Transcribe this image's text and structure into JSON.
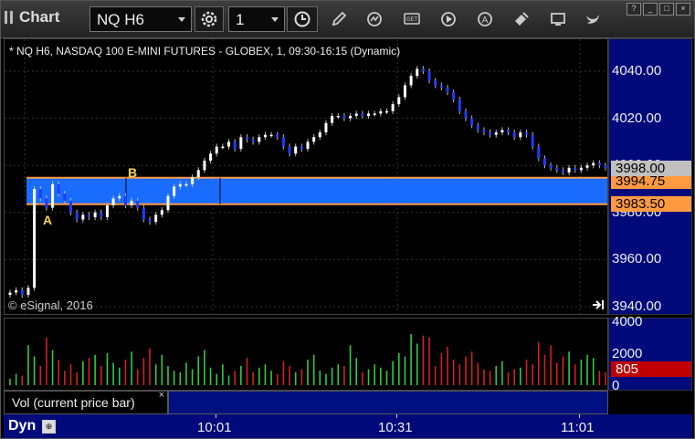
{
  "toolbar": {
    "title": "Chart",
    "symbol": "NQ H6",
    "interval": "1",
    "icons": [
      "settings-icon",
      "clock-icon",
      "pencil-icon",
      "refresh-icon",
      "get-icon",
      "play-icon",
      "alert-icon",
      "eraser-icon",
      "screen-icon",
      "bird-icon"
    ],
    "window_controls": [
      "?",
      "_",
      "□",
      "×"
    ]
  },
  "chart": {
    "header": "* NQ H6, NASDAQ 100 E-MINI FUTURES - GLOBEX, 1, 09:30-16:15 (Dynamic)",
    "copyright": "© eSignal, 2016",
    "label_a": "A",
    "label_b": "B",
    "last_price": "3998.00",
    "band_upper_label": "3994.75",
    "band_lower_label": "3983.50",
    "band_color": "#1a6cff",
    "band_border_color": "#ff9a40",
    "up_color": "#ffffff",
    "down_color": "#1f3cff"
  },
  "chart_data": {
    "type": "candlestick",
    "y_ticks": [
      "4040.00",
      "4020.00",
      "4000.00",
      "3980.00",
      "3960.00",
      "3940.00"
    ],
    "ylim": [
      3935,
      4045
    ],
    "x_ticks": [
      "10:01",
      "10:31",
      "11:01"
    ],
    "band": {
      "upper": 3994.75,
      "lower": 3983.5
    },
    "close_series": [
      3946,
      3947,
      3945,
      3948,
      3990,
      3986,
      3982,
      3992,
      3988,
      3985,
      3980,
      3977,
      3979,
      3978,
      3980,
      3978,
      3983,
      3986,
      3987,
      3983,
      3985,
      3982,
      3977,
      3976,
      3979,
      3981,
      3987,
      3991,
      3992,
      3992,
      3995,
      3998,
      4002,
      4005,
      4008,
      4008,
      4010,
      4007,
      4012,
      4011,
      4010,
      4012,
      4013,
      4013,
      4012,
      4008,
      4005,
      4008,
      4007,
      4010,
      4012,
      4014,
      4018,
      4021,
      4021,
      4020,
      4021,
      4022,
      4021,
      4022,
      4022,
      4023,
      4023,
      4026,
      4029,
      4034,
      4038,
      4041,
      4040,
      4036,
      4034,
      4033,
      4031,
      4028,
      4023,
      4020,
      4017,
      4015,
      4014,
      4013,
      4014,
      4015,
      4014,
      4012,
      4014,
      4013,
      4008,
      4003,
      4000,
      3999,
      3998,
      3997,
      3999,
      3998,
      3999,
      4000,
      4001,
      4000,
      3999
    ],
    "volume": {
      "y_ticks": [
        "4000",
        "2000",
        "0"
      ],
      "ylim": [
        0,
        4000
      ],
      "last_value": "805",
      "label": "Vol (current price bar)",
      "values": [
        400,
        700,
        600,
        2500,
        1800,
        1200,
        3000,
        2200,
        1600,
        900,
        1300,
        800,
        1500,
        1700,
        1900,
        1200,
        2000,
        1400,
        1100,
        1600,
        2100,
        1000,
        1700,
        2300,
        1300,
        1900,
        1200,
        900,
        800,
        1400,
        1000,
        1800,
        2200,
        1100,
        700,
        1300,
        600,
        900,
        1200,
        1700,
        800,
        1100,
        1300,
        900,
        700,
        1500,
        1200,
        800,
        1000,
        1600,
        1900,
        900,
        700,
        1100,
        1300,
        1200,
        2500,
        1700,
        800,
        1000,
        1300,
        1100,
        900,
        1500,
        2000,
        1800,
        3200,
        2600,
        3100,
        3000,
        1200,
        2000,
        2400,
        1600,
        1300,
        1800,
        2100,
        1400,
        1000,
        900,
        1200,
        1500,
        800,
        1000,
        1100,
        1600,
        1300,
        2700,
        1900,
        2500,
        1400,
        1800,
        2100,
        1300,
        1600,
        1900,
        1700,
        900,
        805
      ]
    }
  },
  "time_axis": {
    "mode_label": "Dyn",
    "labels": [
      "10:01",
      "10:31",
      "11:01"
    ]
  }
}
